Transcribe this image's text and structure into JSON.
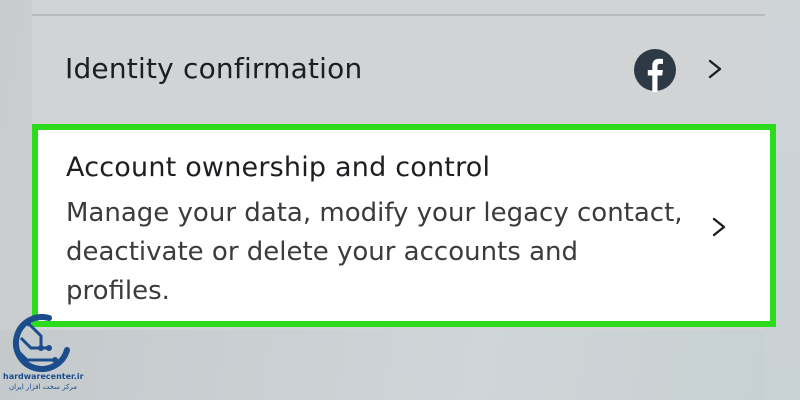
{
  "settings": {
    "identity_confirmation": {
      "label": "Identity confirmation",
      "icon": "facebook-icon"
    },
    "account_ownership": {
      "title": "Account ownership and control",
      "description": "Manage your data, modify your legacy contact, deactivate or delete your accounts and profiles."
    }
  },
  "watermark": {
    "site": "hardwarecenter.ir",
    "subtitle": "مرکز سخت افزار ایران"
  },
  "colors": {
    "highlight_border": "#2cdc1c",
    "facebook_icon": "#2d3a46",
    "text_primary": "#1c1e21"
  }
}
